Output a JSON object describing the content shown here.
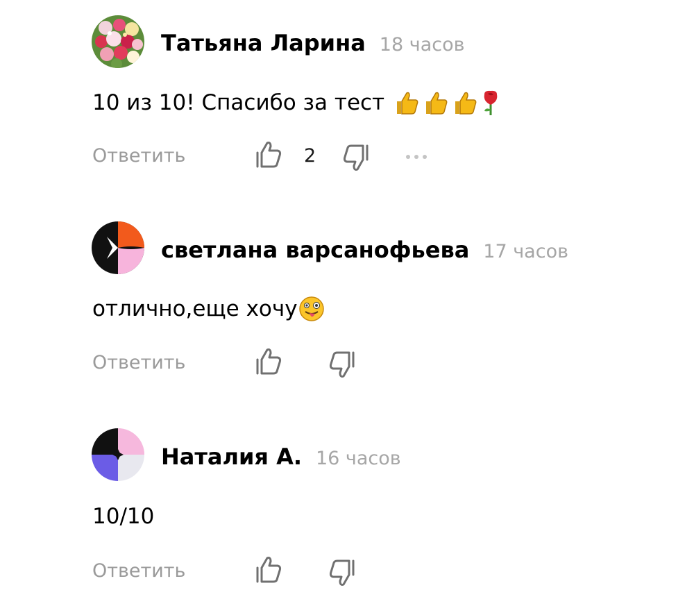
{
  "comments": [
    {
      "author": "Татьяна Ларина",
      "time": "18 часов",
      "text": "10 из 10! Спасибо за тест",
      "emojis": [
        "thumbs-up",
        "thumbs-up",
        "thumbs-up",
        "rose"
      ],
      "reply_label": "Ответить",
      "likes": "2",
      "avatar": "flower-bouquet"
    },
    {
      "author": "светлана варсанофьева",
      "time": "17 часов",
      "text": "отлично,еще хочу",
      "emojis": [
        "winking-face-with-tongue"
      ],
      "reply_label": "Ответить",
      "avatar": "generated-orange-pink-black"
    },
    {
      "author": "Наталия А.",
      "time": "16 часов",
      "text": "10/10",
      "emojis": [],
      "reply_label": "Ответить",
      "avatar": "generated-black-pink-purple"
    }
  ],
  "colors": {
    "meta": "#a6a6a6",
    "reply": "#9a9a9a",
    "icon": "#707070"
  }
}
